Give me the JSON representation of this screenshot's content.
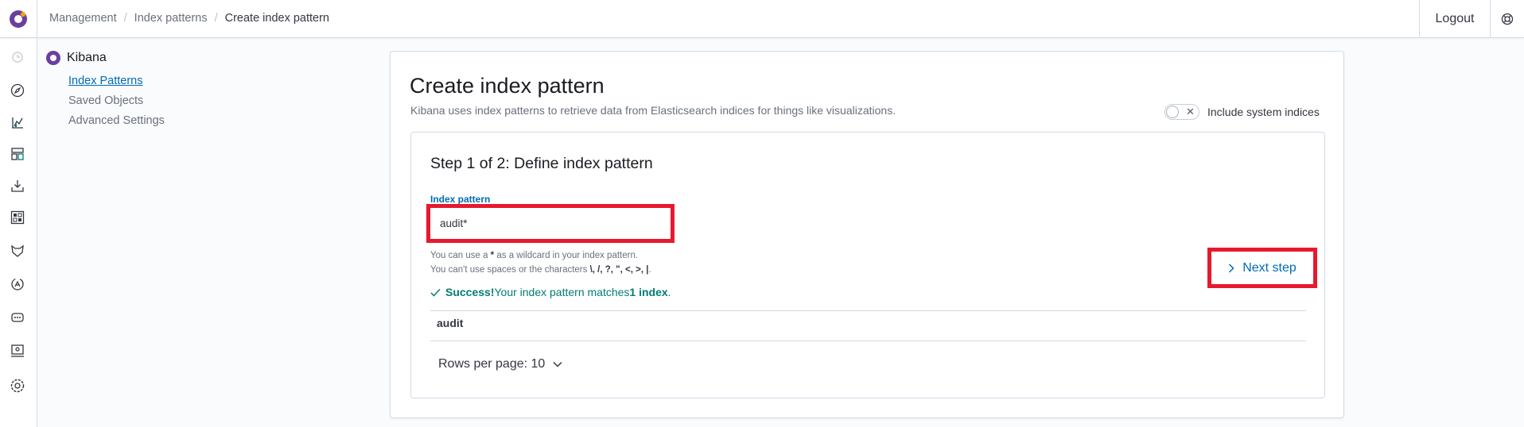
{
  "header": {
    "breadcrumbs": [
      "Management",
      "Index patterns",
      "Create index pattern"
    ],
    "logout_label": "Logout"
  },
  "sidenav": {
    "icons": [
      "clock-icon",
      "compass-icon",
      "visualize-icon",
      "dashboard-icon",
      "download-icon",
      "canvas-icon",
      "ml-icon",
      "apm-icon",
      "dev-tools-icon",
      "monitoring-icon",
      "settings-icon"
    ]
  },
  "sidebar": {
    "title": "Kibana",
    "items": [
      {
        "label": "Index Patterns",
        "active": true
      },
      {
        "label": "Saved Objects",
        "active": false
      },
      {
        "label": "Advanced Settings",
        "active": false
      }
    ]
  },
  "main": {
    "title": "Create index pattern",
    "description": "Kibana uses index patterns to retrieve data from Elasticsearch indices for things like visualizations.",
    "toggle_label": "Include system indices",
    "step": {
      "title": "Step 1 of 2: Define index pattern",
      "field_label": "Index pattern",
      "input_value": "audit*",
      "help_line1_pre": "You can use a ",
      "help_line1_star": "*",
      "help_line1_post": " as a wildcard in your index pattern.",
      "help_line2_pre": "You can't use spaces or the characters ",
      "help_line2_chars": "\\, /, ?, \", <, >, |",
      "help_line2_post": ".",
      "success_strong": "Success!",
      "success_text": " Your index pattern matches ",
      "success_count": "1 index",
      "success_end": ".",
      "results": [
        "audit"
      ],
      "rows_per_page": "Rows per page: 10",
      "next_label": "Next step"
    }
  },
  "colors": {
    "accent": "#006bb4",
    "success": "#017d73",
    "highlight": "#e7192e"
  }
}
